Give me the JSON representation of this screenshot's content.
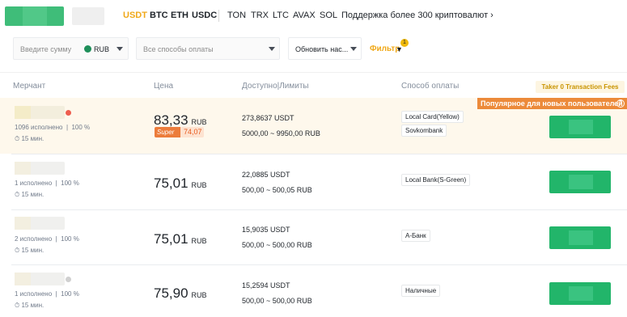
{
  "top_tabs": {
    "coins": [
      "USDT",
      "BTC",
      "ETH",
      "USDC"
    ],
    "more_coins": [
      "TON",
      "TRX",
      "LTC",
      "AVAX",
      "SOL"
    ],
    "more_label": "Поддержка более 300 криптовалют"
  },
  "filters": {
    "amount_placeholder": "Введите сумму",
    "currency": "RUB",
    "payment_placeholder": "Все способы оплаты",
    "refresh_label": "Обновить нас...",
    "filter_label": "Фильтр",
    "filter_count": "1"
  },
  "table": {
    "headers": [
      "Мерчант",
      "Цена",
      "Доступно|Лимиты",
      "Способ оплаты"
    ],
    "taker_badge": "Taker 0 Transaction Fees",
    "popular_banner": "Популярное для новых пользователей",
    "rows": [
      {
        "orders": "1096 исполнено",
        "completion": "100 %",
        "time": "15 мин.",
        "price": "83,33",
        "currency": "RUB",
        "super_label": "Super",
        "super_price": "74,07",
        "available": "273,8637 USDT",
        "limits": "5000,00 ~ 9950,00 RUB",
        "payments": [
          "Local Card(Yellow)",
          "Sovkombank"
        ]
      },
      {
        "orders": "1 исполнено",
        "completion": "100 %",
        "time": "15 мин.",
        "price": "75,01",
        "currency": "RUB",
        "available": "22,0885 USDT",
        "limits": "500,00 ~ 500,05 RUB",
        "payments": [
          "Local Bank(S-Green)"
        ]
      },
      {
        "orders": "2 исполнено",
        "completion": "100 %",
        "time": "15 мин.",
        "price": "75,01",
        "currency": "RUB",
        "available": "15,9035 USDT",
        "limits": "500,00 ~ 500,00 RUB",
        "payments": [
          "А-Банк"
        ]
      },
      {
        "orders": "1 исполнено",
        "completion": "100 %",
        "time": "15 мин.",
        "price": "75,90",
        "currency": "RUB",
        "available": "15,2594 USDT",
        "limits": "500,00 ~ 500,00 RUB",
        "payments": [
          "Наличные"
        ]
      }
    ]
  },
  "colors": {
    "accent": "#f0a818",
    "buy_green": "#22b56a",
    "highlight_row": "#fef8ec",
    "popular_orange": "#ec8a3a"
  }
}
